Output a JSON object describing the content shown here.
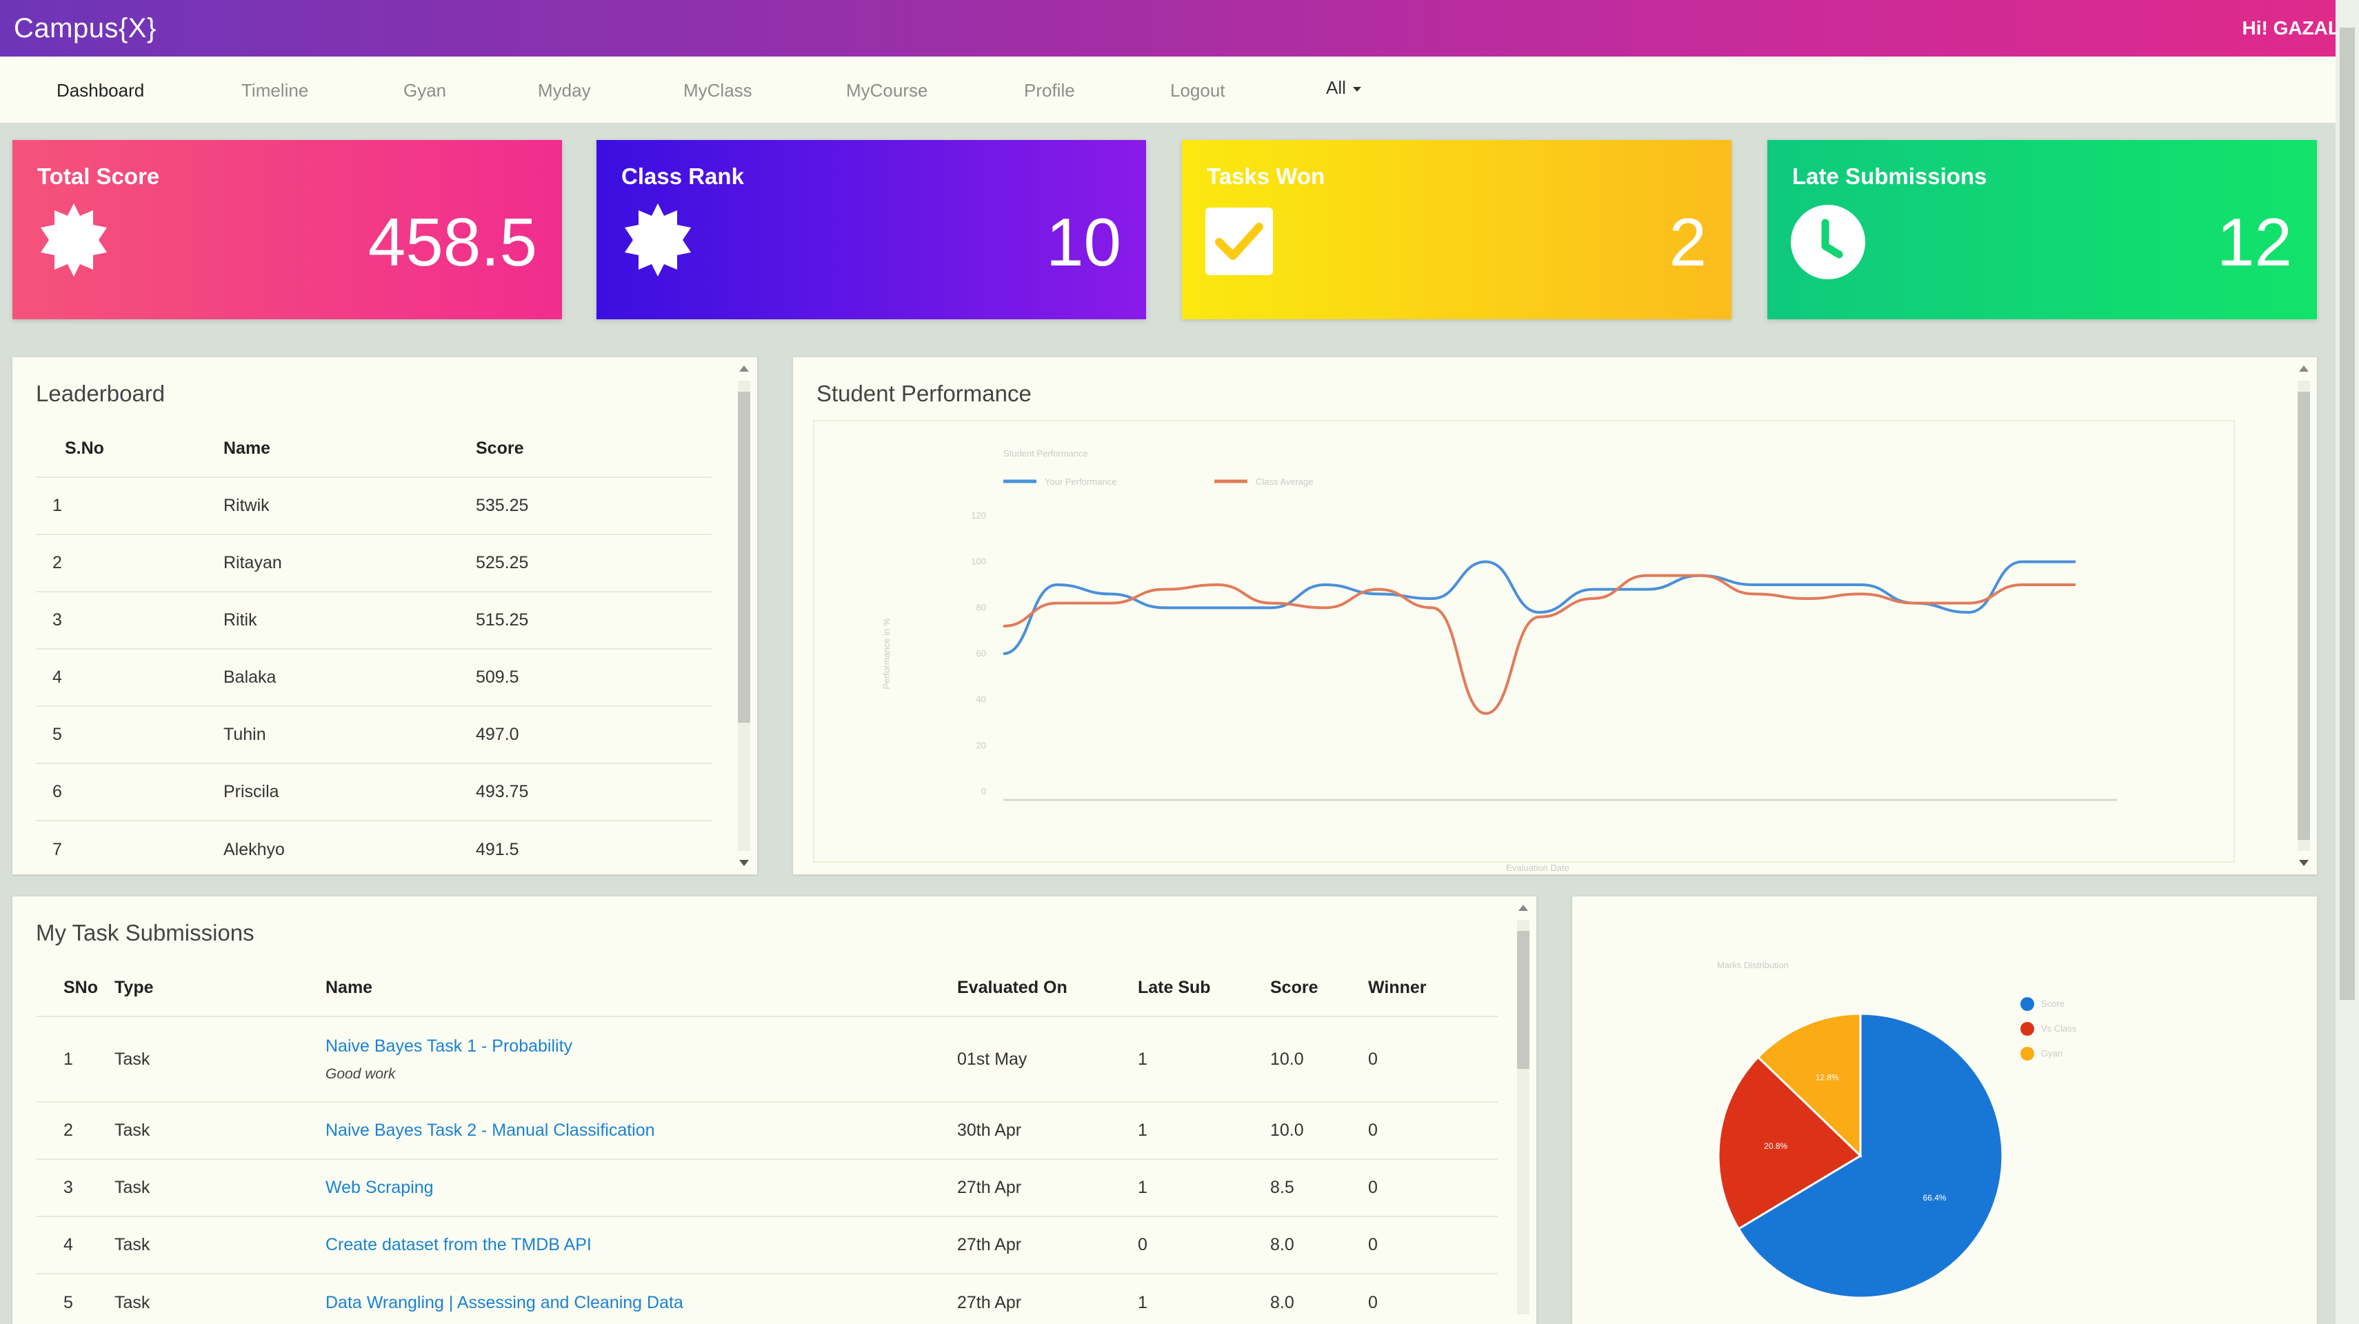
{
  "header": {
    "brand": "Campus{X}",
    "greeting": "Hi! GAZAL"
  },
  "nav": {
    "items": [
      {
        "label": "Dashboard",
        "active": true
      },
      {
        "label": "Timeline"
      },
      {
        "label": "Gyan"
      },
      {
        "label": "Myday"
      },
      {
        "label": "MyClass"
      },
      {
        "label": "MyCourse"
      },
      {
        "label": "Profile"
      },
      {
        "label": "Logout"
      }
    ],
    "filter": "All"
  },
  "cards": [
    {
      "title": "Total Score",
      "value": "458.5",
      "icon": "badge-icon"
    },
    {
      "title": "Class Rank",
      "value": "10",
      "icon": "badge-icon"
    },
    {
      "title": "Tasks Won",
      "value": "2",
      "icon": "check-icon"
    },
    {
      "title": "Late Submissions",
      "value": "12",
      "icon": "clock-icon"
    }
  ],
  "leaderboard": {
    "title": "Leaderboard",
    "columns": [
      "S.No",
      "Name",
      "Score"
    ],
    "rows": [
      [
        "1",
        "Ritwik",
        "535.25"
      ],
      [
        "2",
        "Ritayan",
        "525.25"
      ],
      [
        "3",
        "Ritik",
        "515.25"
      ],
      [
        "4",
        "Balaka",
        "509.5"
      ],
      [
        "5",
        "Tuhin",
        "497.0"
      ],
      [
        "6",
        "Priscila",
        "493.75"
      ],
      [
        "7",
        "Alekhyo",
        "491.5"
      ]
    ]
  },
  "performance": {
    "title": "Student Performance"
  },
  "chart_data": [
    {
      "type": "line",
      "title": "Student Performance",
      "xlabel": "Evaluation Date",
      "ylabel": "Performance in %",
      "ylim": [
        0,
        120
      ],
      "yticks": [
        0,
        20,
        40,
        60,
        80,
        100,
        120
      ],
      "legend": "top-left",
      "series": [
        {
          "name": "Your Performance",
          "color": "#4a90d9",
          "values": [
            60,
            90,
            86,
            80,
            80,
            80,
            90,
            86,
            84,
            100,
            78,
            88,
            88,
            94,
            90,
            90,
            90,
            82,
            78,
            100,
            100
          ]
        },
        {
          "name": "Class Average",
          "color": "#e07b5a",
          "values": [
            72,
            82,
            82,
            88,
            90,
            82,
            80,
            88,
            80,
            34,
            76,
            84,
            94,
            94,
            86,
            84,
            86,
            82,
            82,
            90,
            90
          ]
        }
      ]
    },
    {
      "type": "pie",
      "title": "Marks Distribution",
      "legend": "right",
      "series": [
        {
          "name": "Score",
          "color": "#1877d6",
          "value": 66.4,
          "label": "66.4%"
        },
        {
          "name": "Vs Class",
          "color": "#dc3318",
          "value": 20.8,
          "label": "20.8%"
        },
        {
          "name": "Gyan",
          "color": "#fbab16",
          "value": 12.8,
          "label": "12.8%"
        }
      ]
    }
  ],
  "tasks": {
    "title": "My Task Submissions",
    "columns": [
      "SNo",
      "Type",
      "Name",
      "Evaluated On",
      "Late Sub",
      "Score",
      "Winner"
    ],
    "rows": [
      {
        "sno": "1",
        "type": "Task",
        "name": "Naive Bayes Task 1 - Probability",
        "note": "Good work",
        "evaluated": "01st May",
        "late": "1",
        "score": "10.0",
        "winner": "0"
      },
      {
        "sno": "2",
        "type": "Task",
        "name": "Naive Bayes Task 2 - Manual Classification",
        "note": "",
        "evaluated": "30th Apr",
        "late": "1",
        "score": "10.0",
        "winner": "0"
      },
      {
        "sno": "3",
        "type": "Task",
        "name": "Web Scraping",
        "note": "",
        "evaluated": "27th Apr",
        "late": "1",
        "score": "8.5",
        "winner": "0"
      },
      {
        "sno": "4",
        "type": "Task",
        "name": "Create dataset from the TMDB API",
        "note": "",
        "evaluated": "27th Apr",
        "late": "0",
        "score": "8.0",
        "winner": "0"
      },
      {
        "sno": "5",
        "type": "Task",
        "name": "Data Wrangling | Assessing and Cleaning Data",
        "note": "",
        "evaluated": "27th Apr",
        "late": "1",
        "score": "8.0",
        "winner": "0"
      }
    ]
  }
}
